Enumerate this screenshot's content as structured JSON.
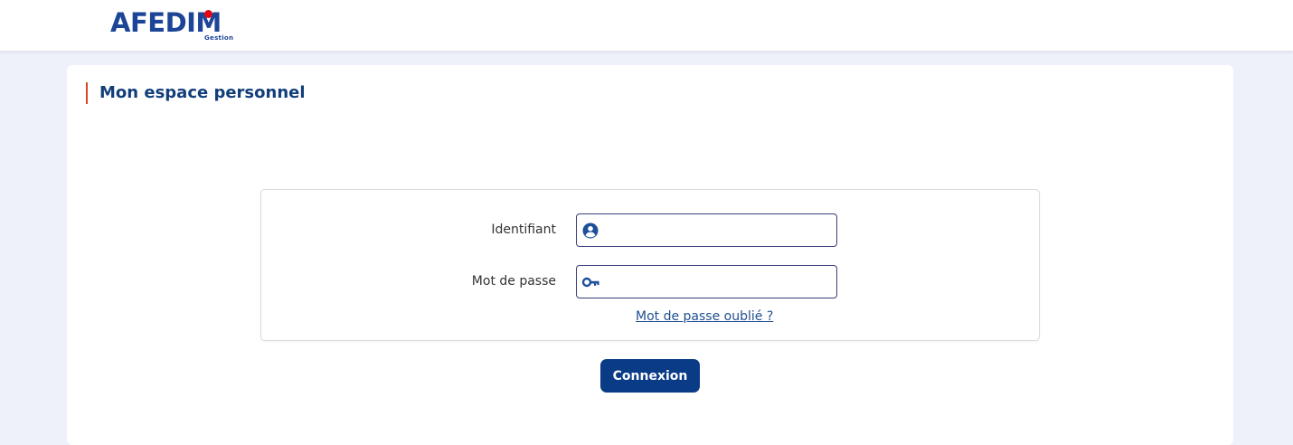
{
  "header": {
    "logo_text": "AFEDIM",
    "logo_subtext": "Gestion",
    "logo_color": "#1d4597",
    "logo_dot_color": "#e30613"
  },
  "page": {
    "title": "Mon espace personnel",
    "title_accent_color": "#d9452b",
    "title_color": "#123e7a"
  },
  "login": {
    "username": {
      "label": "Identifiant",
      "value": "",
      "icon": "user-circle-icon"
    },
    "password": {
      "label": "Mot de passe",
      "value": "",
      "icon": "key-icon"
    },
    "forgot_link": "Mot de passe oublié ?",
    "submit_label": "Connexion",
    "accent_color": "#0a3b87"
  }
}
